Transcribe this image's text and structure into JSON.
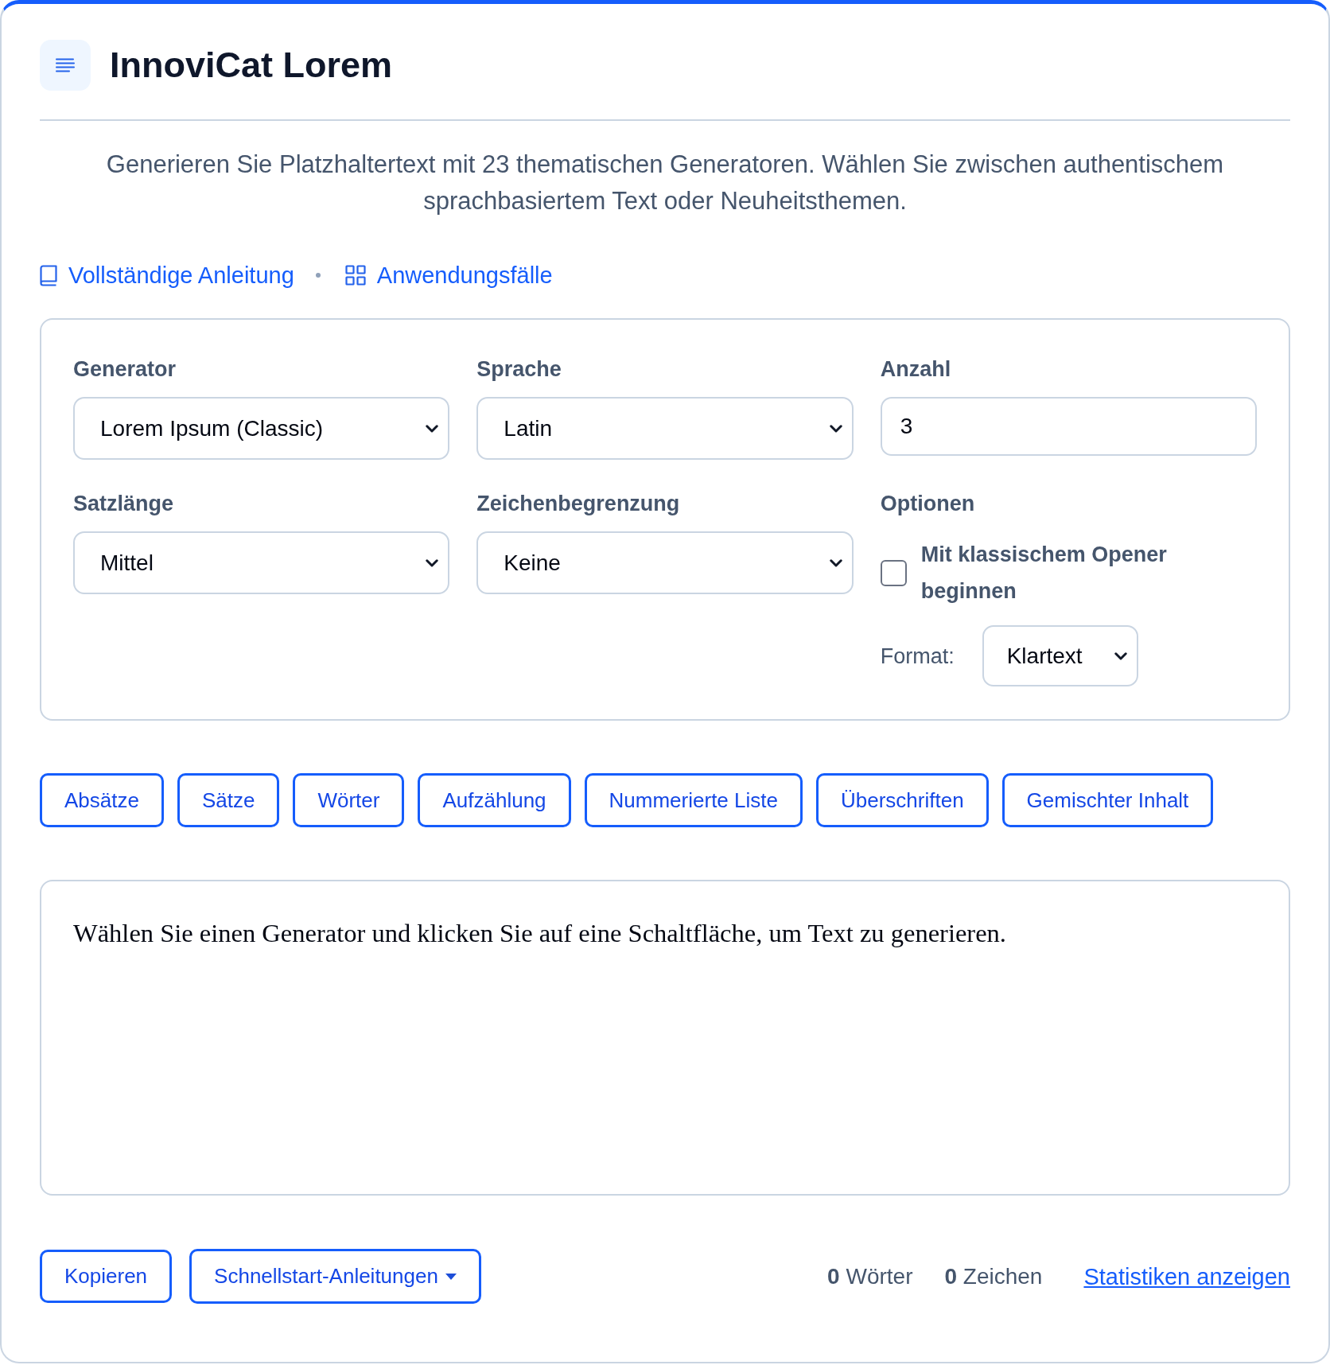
{
  "header": {
    "title": "InnoviCat Lorem"
  },
  "description": "Generieren Sie Platzhaltertext mit 23 thematischen Generatoren. Wählen Sie zwischen authentischem sprachbasiertem Text oder Neuheitsthemen.",
  "links": [
    {
      "label": "Vollständige Anleitung"
    },
    {
      "label": "Anwendungsfälle"
    }
  ],
  "settings": {
    "fields": [
      {
        "kind": "select",
        "label": "Generator",
        "value": "Lorem Ipsum (Classic)"
      },
      {
        "kind": "select",
        "label": "Sprache",
        "value": "Latin"
      },
      {
        "kind": "number",
        "label": "Anzahl",
        "value": "3"
      },
      {
        "kind": "select",
        "label": "Satzlänge",
        "value": "Mittel"
      },
      {
        "kind": "select",
        "label": "Zeichenbegrenzung",
        "value": "Keine"
      },
      {
        "kind": "options",
        "label": "Optionen",
        "checkbox": {
          "label": "Mit klassischem Opener beginnen",
          "checked": false
        },
        "format": {
          "label": "Format:",
          "value": "Klartext"
        }
      }
    ]
  },
  "generate_buttons": [
    {
      "label": "Absätze"
    },
    {
      "label": "Sätze"
    },
    {
      "label": "Wörter"
    },
    {
      "label": "Aufzählung"
    },
    {
      "label": "Nummerierte Liste"
    },
    {
      "label": "Überschriften"
    },
    {
      "label": "Gemischter Inhalt"
    }
  ],
  "output": {
    "text": "Wählen Sie einen Generator und klicken Sie auf eine Schaltfläche, um Text zu generieren."
  },
  "footer": {
    "buttons": [
      {
        "kind": "button",
        "label": "Kopieren"
      },
      {
        "kind": "dropdown",
        "label": "Schnellstart-Anleitungen"
      }
    ],
    "stats": [
      "**0** Wörter",
      "**0** Zeichen"
    ],
    "link": "Statistiken anzeigen"
  }
}
